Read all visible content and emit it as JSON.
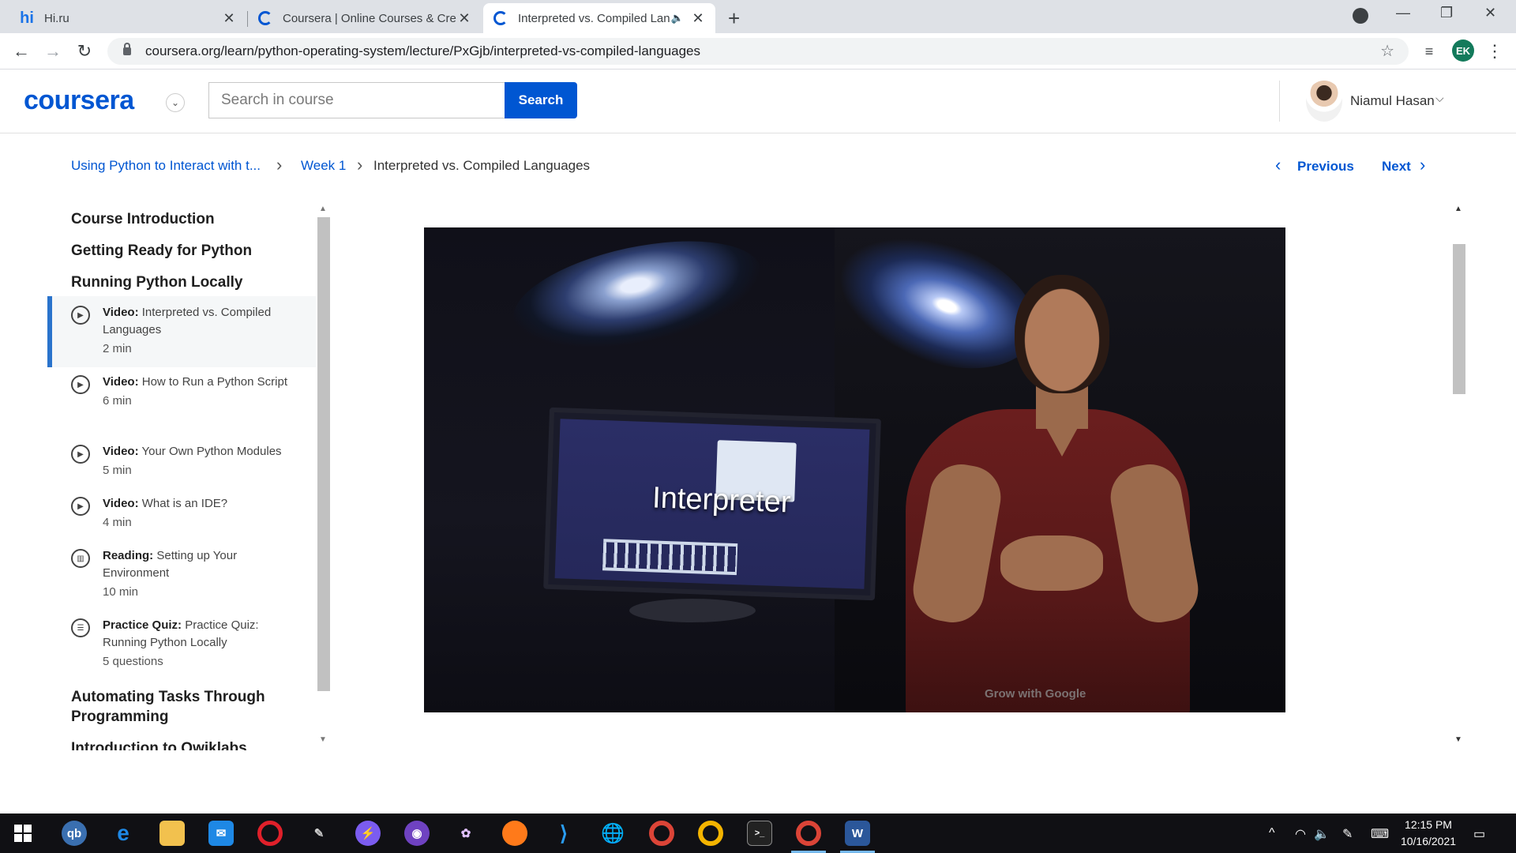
{
  "browser": {
    "tabs": [
      {
        "title": "Hi.ru",
        "favicon": "hi"
      },
      {
        "title": "Coursera | Online Courses & Cred",
        "favicon": "coursera-icon"
      },
      {
        "title": "Interpreted vs. Compiled Lan",
        "favicon": "coursera-icon"
      }
    ],
    "url": "coursera.org/learn/python-operating-system/lecture/PxGjb/interpreted-vs-compiled-languages",
    "profile_initials": "EK"
  },
  "header": {
    "logo": "coursera",
    "search_placeholder": "Search in course",
    "search_button": "Search",
    "user_name": "Niamul Hasan"
  },
  "breadcrumb": {
    "course": "Using Python to Interact with t...",
    "week": "Week 1",
    "current": "Interpreted vs. Compiled Languages"
  },
  "nav": {
    "previous": "Previous",
    "next": "Next"
  },
  "sidebar": {
    "sections": [
      "Course Introduction",
      "Getting Ready for Python",
      "Running Python Locally",
      "Automating Tasks Through Programming",
      "Introduction to Qwiklabs"
    ],
    "items": [
      {
        "type": "Video:",
        "title": "Interpreted vs. Compiled Languages",
        "duration": "2 min",
        "icon": "play-icon"
      },
      {
        "type": "Video:",
        "title": "How to Run a Python Script",
        "duration": "6 min",
        "icon": "play-icon"
      },
      {
        "type": "Video:",
        "title": "Your Own Python Modules",
        "duration": "5 min",
        "icon": "play-icon"
      },
      {
        "type": "Video:",
        "title": "What is an IDE?",
        "duration": "4 min",
        "icon": "play-icon"
      },
      {
        "type": "Reading:",
        "title": "Setting up Your Environment",
        "duration": "10 min",
        "icon": "book-icon"
      },
      {
        "type": "Practice Quiz:",
        "title": "Practice Quiz: Running Python Locally",
        "duration": "5 questions",
        "icon": "quiz-icon"
      }
    ]
  },
  "video": {
    "overlay_text": "Interpreter",
    "watermark": "Grow with Google"
  },
  "taskbar": {
    "time": "12:15 PM",
    "date": "10/16/2021"
  }
}
